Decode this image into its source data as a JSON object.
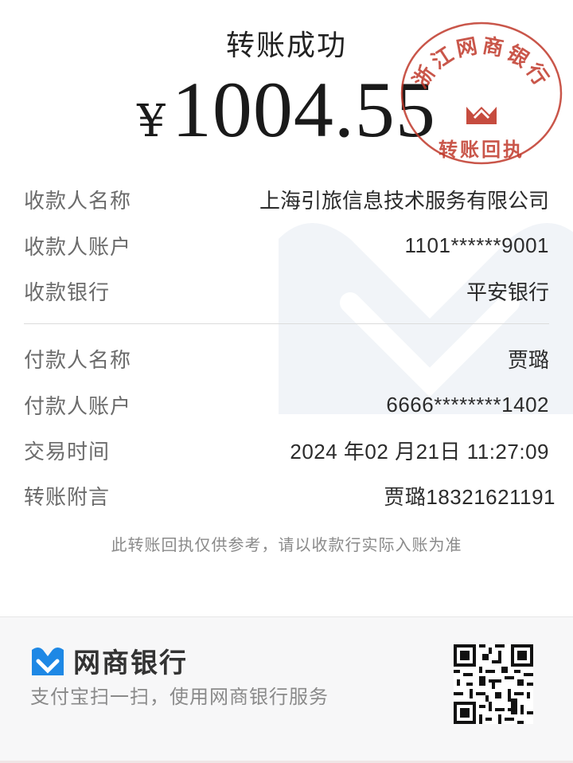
{
  "header": {
    "title": "转账成功",
    "currency": "¥",
    "amount": "1004.55"
  },
  "stamp": {
    "bank_name": "浙江网商银行",
    "receipt_text": "转账回执",
    "color": "#c0392b"
  },
  "payee": {
    "name_label": "收款人名称",
    "name_value": "上海引旅信息技术服务有限公司",
    "account_label": "收款人账户",
    "account_value": "1101******9001",
    "bank_label": "收款银行",
    "bank_value": "平安银行"
  },
  "payer": {
    "name_label": "付款人名称",
    "name_value": "贾璐",
    "account_label": "付款人账户",
    "account_value": "6666********1402",
    "time_label": "交易时间",
    "time_value": "2024 年02 月21日  11:27:09",
    "memo_label": "转账附言",
    "memo_value": "贾璐18321621191"
  },
  "note": "此转账回执仅供参考，请以收款行实际入账为准",
  "footer": {
    "brand_name": "网商银行",
    "brand_sub": "支付宝扫一扫，使用网商银行服务",
    "brand_color": "#1e88e5",
    "icons": [
      "mybank-logo-icon",
      "qr-code-icon"
    ]
  }
}
